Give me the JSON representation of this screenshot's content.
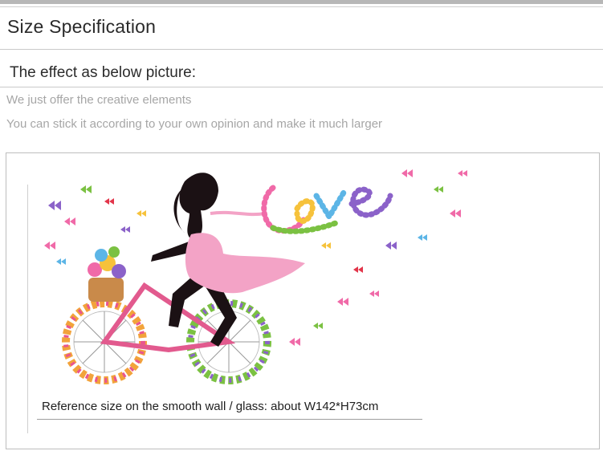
{
  "header": {
    "title": "Size Specification"
  },
  "content": {
    "subtitle": "The effect as below picture:",
    "notes": [
      "We just offer the creative elements",
      "You can stick it according to your own opinion and make it much larger"
    ],
    "reference": "Reference size on the smooth wall / glass: about W142*H73cm"
  },
  "colors": {
    "accent_pink": "#f06aa8",
    "silhouette": "#1b1114",
    "text_dark": "#2a2a2a",
    "text_muted": "#a6a6a6"
  }
}
